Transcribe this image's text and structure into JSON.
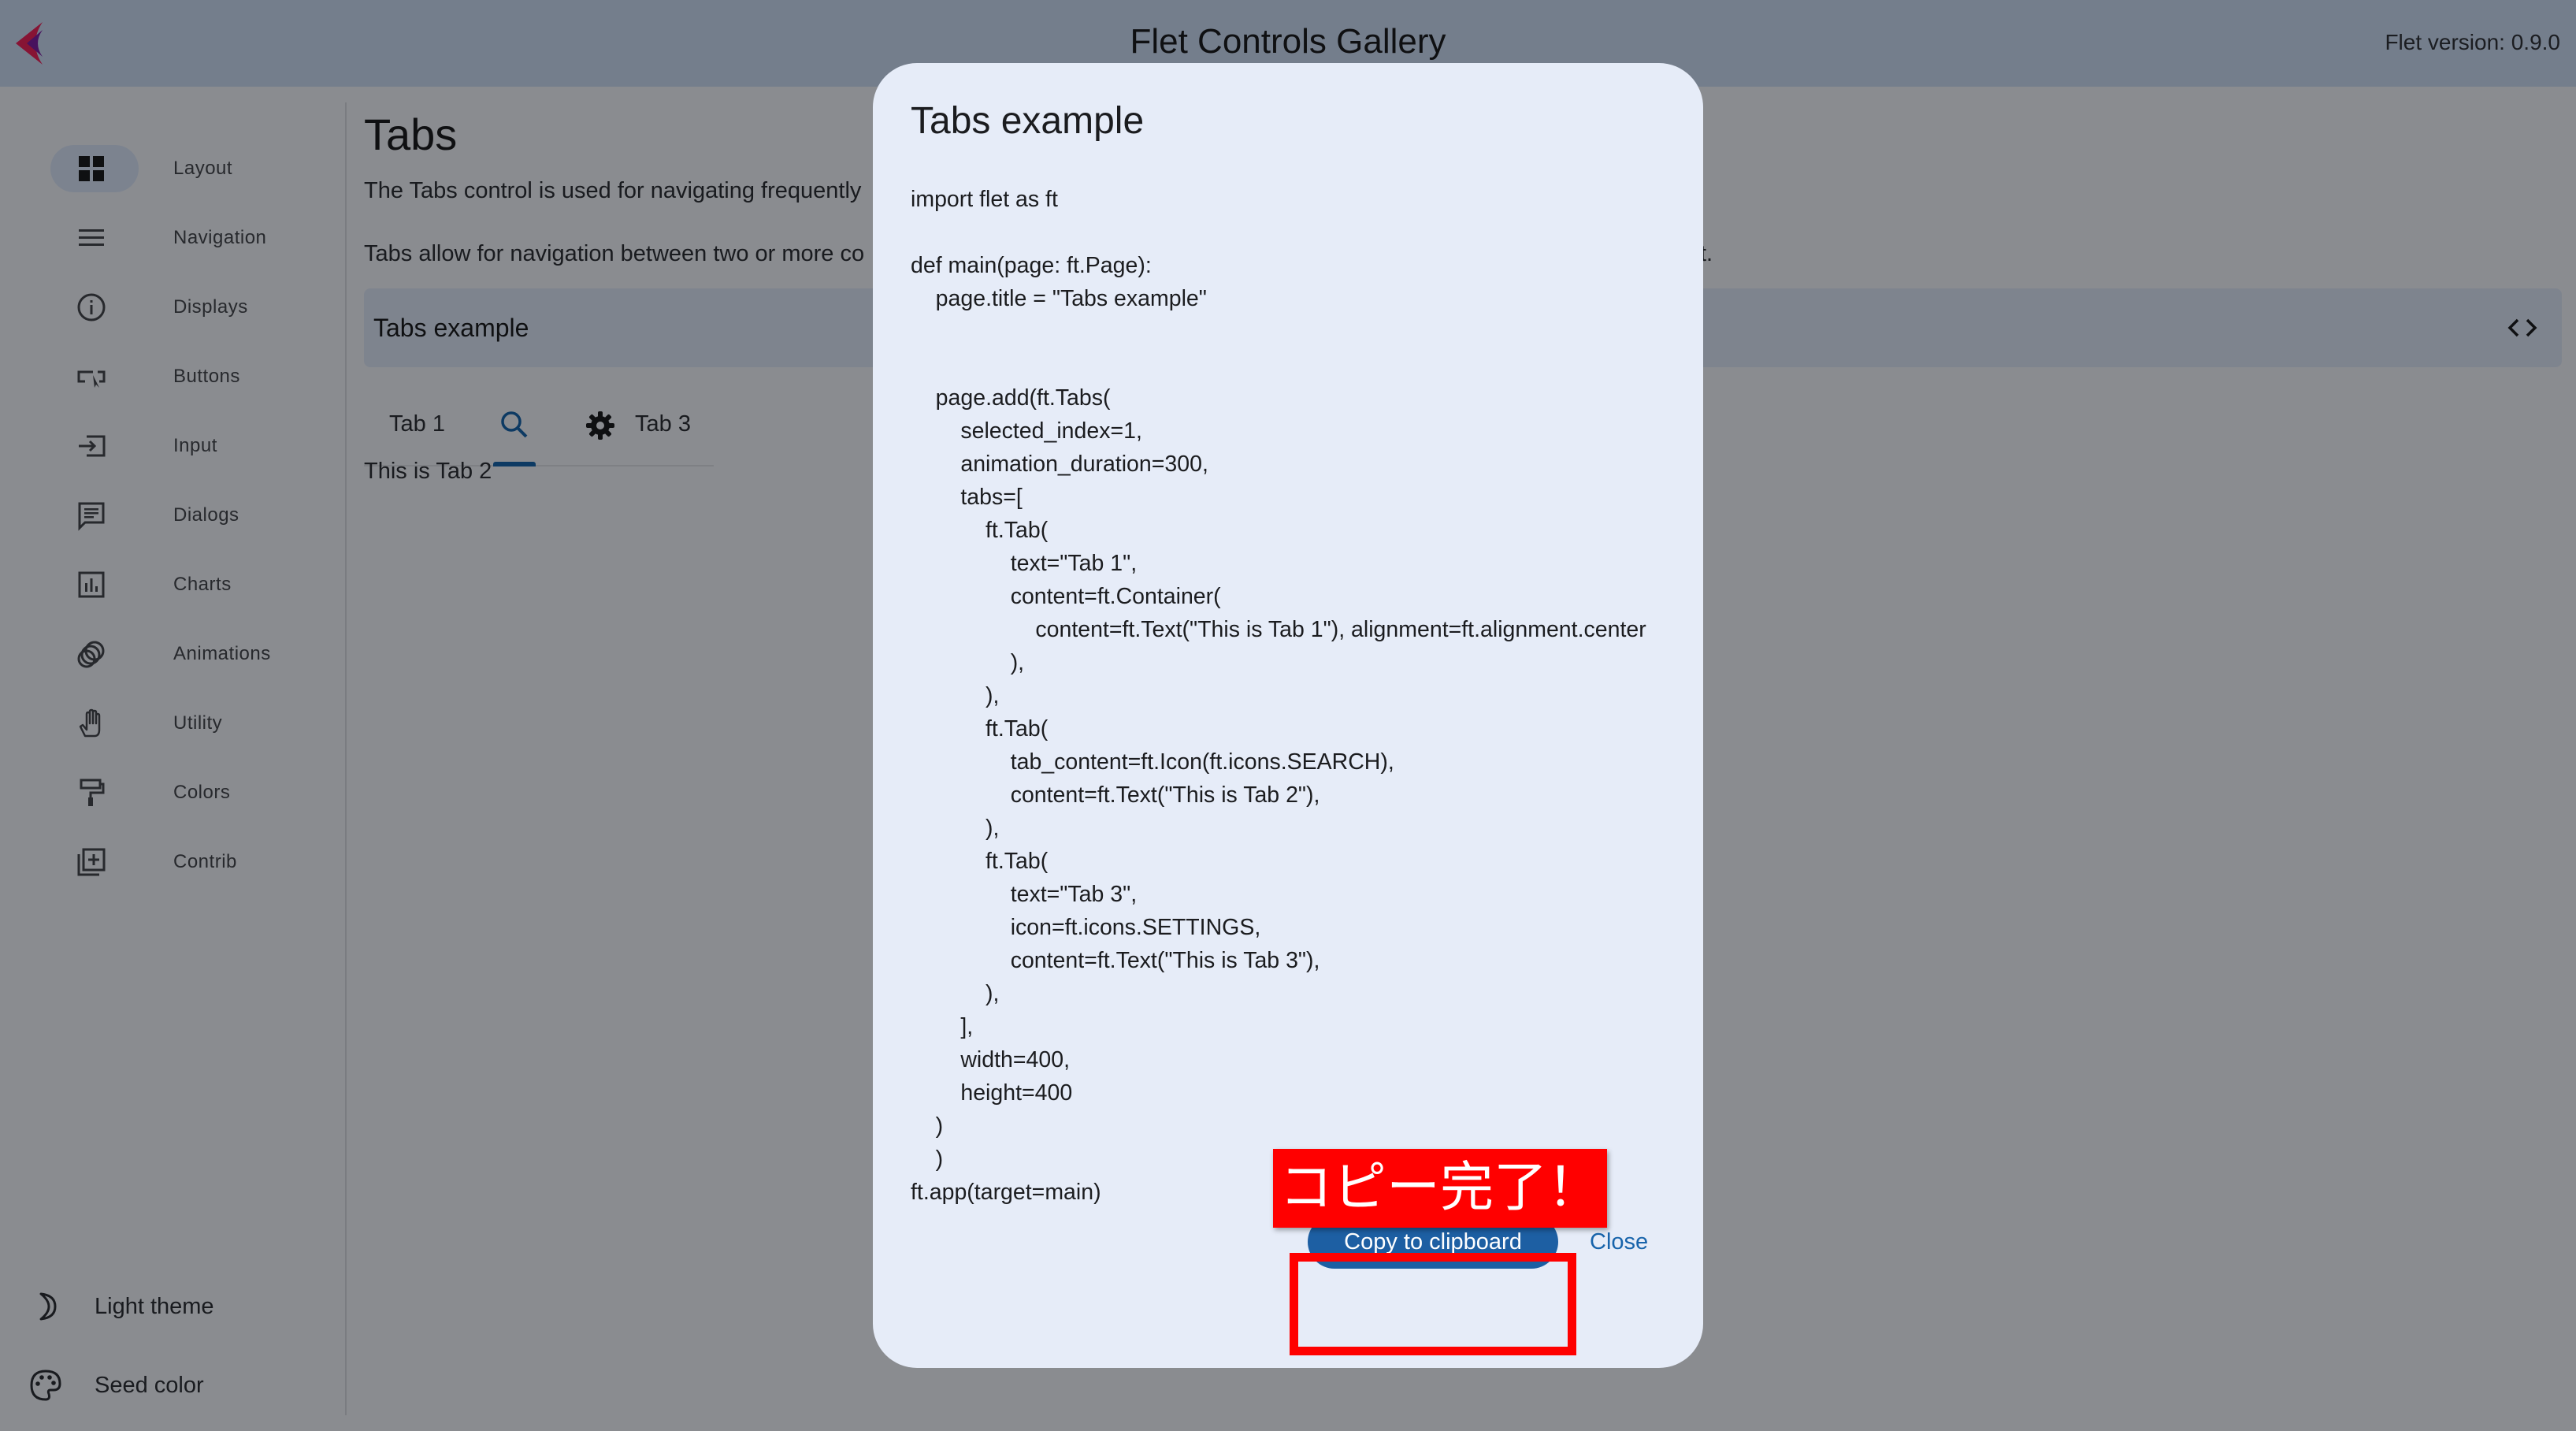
{
  "app": {
    "title": "Flet Controls Gallery",
    "version": "Flet version: 0.9.0",
    "logo_icon": "flet-logo-icon"
  },
  "rail": {
    "items": [
      {
        "label": "Layout",
        "icon": "grid-view-icon",
        "active": true
      },
      {
        "label": "Navigation",
        "icon": "menu-icon"
      },
      {
        "label": "Displays",
        "icon": "info-icon"
      },
      {
        "label": "Buttons",
        "icon": "smart-button-icon"
      },
      {
        "label": "Input",
        "icon": "input-icon"
      },
      {
        "label": "Dialogs",
        "icon": "chat-icon"
      },
      {
        "label": "Charts",
        "icon": "bar-chart-icon"
      },
      {
        "label": "Animations",
        "icon": "animation-icon"
      },
      {
        "label": "Utility",
        "icon": "hand-icon"
      },
      {
        "label": "Colors",
        "icon": "paint-roller-icon"
      },
      {
        "label": "Contrib",
        "icon": "library-add-icon"
      }
    ],
    "bottom": [
      {
        "label": "Light theme",
        "icon": "moon-icon"
      },
      {
        "label": "Seed color",
        "icon": "palette-icon"
      }
    ]
  },
  "content": {
    "title": "Tabs",
    "description_1": "The Tabs control is used for navigating frequently",
    "description_2_start": "Tabs allow for navigation between two or more co",
    "description_2_end": "t.",
    "example_title": "Tabs example",
    "tabs": [
      {
        "label": "Tab 1"
      },
      {
        "icon": "search-icon"
      },
      {
        "label": "Tab 3",
        "icon": "settings-icon"
      }
    ],
    "selected_tab_text": "This is Tab 2"
  },
  "dialog": {
    "title": "Tabs example",
    "code": "import flet as ft\n\ndef main(page: ft.Page):\n    page.title = \"Tabs example\"\n\n\n    page.add(ft.Tabs(\n        selected_index=1,\n        animation_duration=300,\n        tabs=[\n            ft.Tab(\n                text=\"Tab 1\",\n                content=ft.Container(\n                    content=ft.Text(\"This is Tab 1\"), alignment=ft.alignment.center\n                ),\n            ),\n            ft.Tab(\n                tab_content=ft.Icon(ft.icons.SEARCH),\n                content=ft.Text(\"This is Tab 2\"),\n            ),\n            ft.Tab(\n                text=\"Tab 3\",\n                icon=ft.icons.SETTINGS,\n                content=ft.Text(\"This is Tab 3\"),\n            ),\n        ],\n        width=400,\n        height=400\n    )\n    )\nft.app(target=main)",
    "copy_label": "Copy to clipboard",
    "close_label": "Close"
  },
  "annotation": {
    "text": "コピー完了！",
    "color": "#ff0000"
  }
}
